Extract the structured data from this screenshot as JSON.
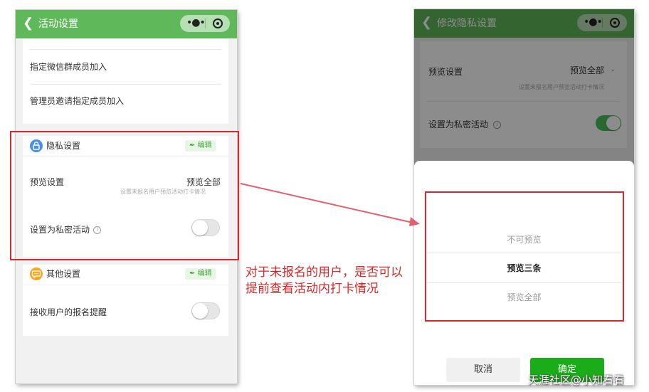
{
  "left_screen": {
    "nav": {
      "back_icon": "chevron-left-icon",
      "title": "活动设置"
    },
    "join_rows": [
      "指定微信群成员加入",
      "管理员邀请指定成员加入"
    ],
    "privacy_section": {
      "icon": "lock-icon",
      "title": "隐私设置",
      "edit_label": "编辑",
      "preview": {
        "label": "预览设置",
        "value": "预览全部",
        "hint": "设置未报名用户预览活动打卡情况"
      },
      "private_activity": {
        "label": "设置为私密活动",
        "enabled": false
      }
    },
    "other_section": {
      "icon": "chat-icon",
      "title": "其他设置",
      "edit_label": "编辑",
      "signup_reminder": {
        "label": "接收用户的报名提醒",
        "enabled": false
      }
    }
  },
  "right_screen": {
    "nav": {
      "back_icon": "chevron-left-icon",
      "title": "修改隐私设置"
    },
    "preview": {
      "label": "预览设置",
      "value": "预览全部",
      "hint": "设置未报名用户预览活动打卡情况"
    },
    "private_activity": {
      "label": "设置为私密活动",
      "enabled": true
    },
    "picker": {
      "options": [
        "不可预览",
        "预览三条",
        "预览全部"
      ],
      "selected": "预览三条",
      "cancel_label": "取消",
      "confirm_label": "确定"
    }
  },
  "annotation": {
    "text": "对于未报名的用户，是否可以提前查看活动内打卡情况"
  },
  "watermark": "天涯社区@小知看看",
  "colors": {
    "nav_green": "#5fb95a",
    "toggle_green": "#4cbf5a",
    "confirm_green": "#1aad19",
    "annotation_red": "#d9272e"
  }
}
